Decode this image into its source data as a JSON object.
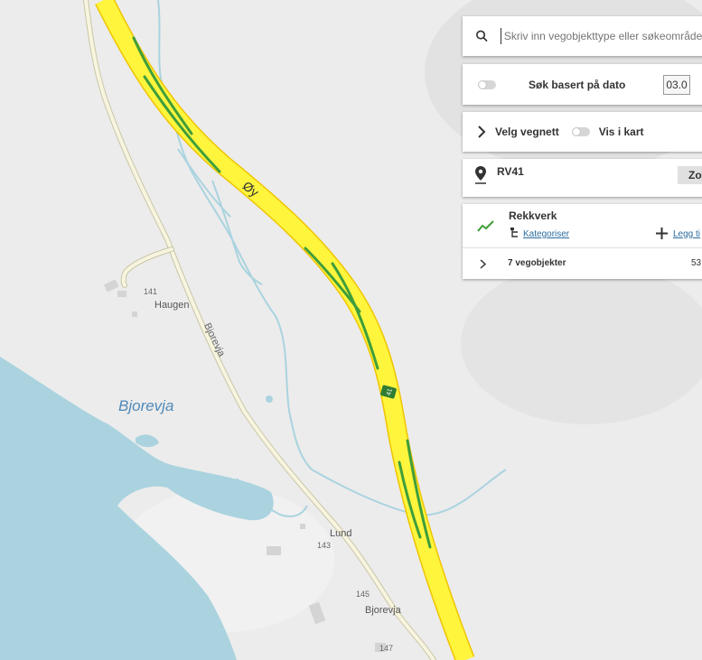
{
  "map": {
    "place_labels": {
      "bjorevja_water": "Bjorevja",
      "haugen": "Haugen",
      "lund": "Lund",
      "bjorevja_farm": "Bjorevja",
      "road_name": "Bjorevja",
      "road_main": "Øy",
      "road_shield": "41"
    },
    "house_numbers": {
      "n141": "141",
      "n143": "143",
      "n145": "145",
      "n147": "147"
    },
    "colors": {
      "background": "#ececec",
      "water": "#aad3df",
      "main_road": "#fff53d",
      "main_road_casing": "#f0c400",
      "highlight": "#3f9e3a",
      "minor_road": "#efedcc"
    }
  },
  "search": {
    "placeholder": "Skriv inn vegobjekttype eller søkeområde"
  },
  "date_filter": {
    "label": "Søk basert på dato",
    "date_value": "03.0"
  },
  "network": {
    "label": "Velg vegnett",
    "show_on_map": "Vis i kart"
  },
  "location": {
    "road": "RV41",
    "zoom_button": "Zo"
  },
  "object_type": {
    "name": "Rekkverk",
    "categorize": "Kategoriser",
    "add": "Legg ti",
    "count_label": "7 vegobjekter",
    "count_value": "53"
  }
}
